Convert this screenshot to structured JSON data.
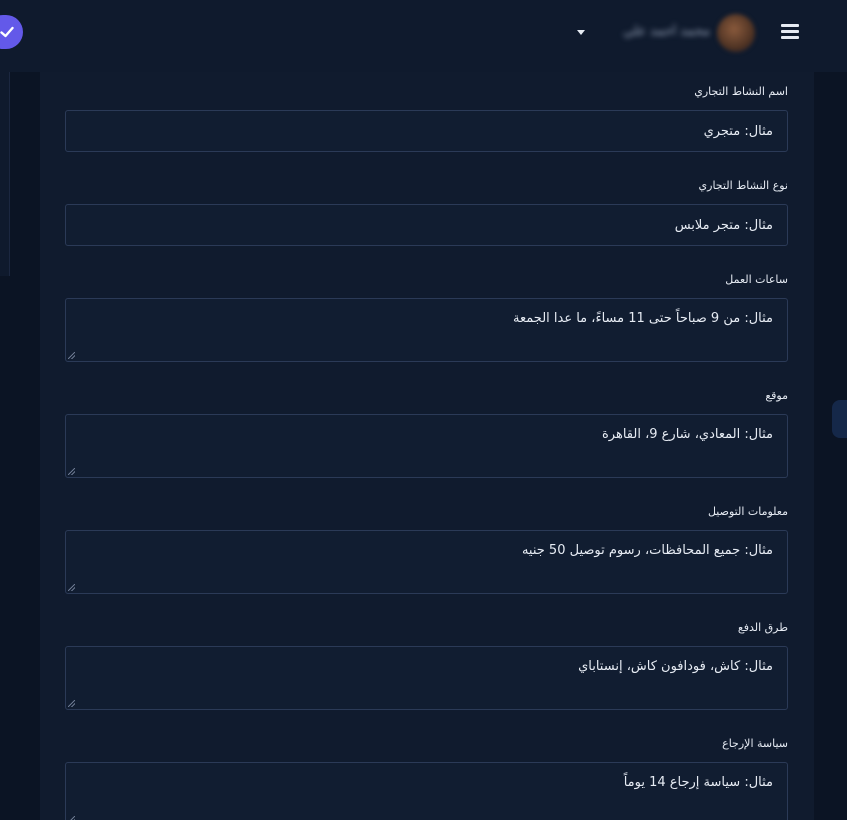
{
  "header": {
    "user_name": "محمد أحمد علي",
    "colors": {
      "badge": "#6359e9",
      "background": "#0f1a2d"
    }
  },
  "form": {
    "fields": [
      {
        "label": "اسم النشاط التجاري",
        "placeholder": "مثال: متجري",
        "type": "input"
      },
      {
        "label": "نوع النشاط التجاري",
        "placeholder": "مثال: متجر ملابس",
        "type": "input"
      },
      {
        "label": "ساعات العمل",
        "placeholder": "مثال: من 9 صباحاً حتى 11 مساءً، ما عدا الجمعة",
        "type": "textarea"
      },
      {
        "label": "موقع",
        "placeholder": "مثال: المعادي، شارع 9، القاهرة",
        "type": "textarea"
      },
      {
        "label": "معلومات التوصيل",
        "placeholder": "مثال: جميع المحافظات، رسوم توصيل 50 جنيه",
        "type": "textarea"
      },
      {
        "label": "طرق الدفع",
        "placeholder": "مثال: كاش، فودافون كاش، إنستاباي",
        "type": "textarea"
      },
      {
        "label": "سياسة الإرجاع",
        "placeholder": "مثال: سياسة إرجاع 14 يوماً",
        "type": "textarea"
      }
    ]
  }
}
